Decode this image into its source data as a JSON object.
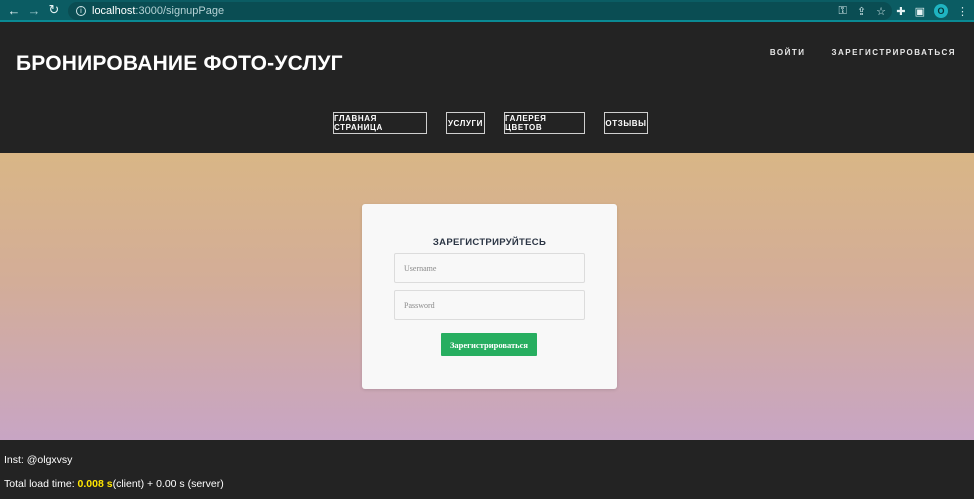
{
  "browser": {
    "url_host": "localhost",
    "url_path": ":3000/signupPage",
    "profile_initial": "O"
  },
  "header": {
    "title": "БРОНИРОВАНИЕ ФОТО-УСЛУГ",
    "auth": {
      "login": "ВОЙТИ",
      "register": "ЗАРЕГИСТРИРОВАТЬСЯ"
    },
    "nav": [
      {
        "label": "ГЛАВНАЯ СТРАНИЦА"
      },
      {
        "label": "УСЛУГИ"
      },
      {
        "label": "ГАЛЕРЕЯ ЦВЕТОВ"
      },
      {
        "label": "ОТЗЫВЫ"
      }
    ]
  },
  "form": {
    "title": "ЗАРЕГИСТРИРУЙТЕСЬ",
    "username_placeholder": "Username",
    "password_placeholder": "Password",
    "submit_label": "Зарегистрироваться"
  },
  "footer": {
    "inst": "Inst: @olgxvsy",
    "load_prefix": "Total load time: ",
    "load_client_value": "0.008 s",
    "load_suffix": "(client) + 0.00 s (server)"
  },
  "colors": {
    "accent_green": "#27ae60",
    "chrome_teal": "#0b5c63",
    "highlight_yellow": "#ffe600"
  }
}
